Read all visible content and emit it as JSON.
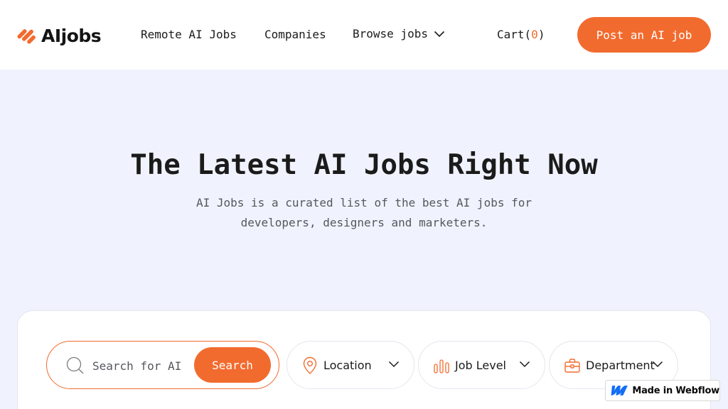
{
  "header": {
    "logo_text": "AIjobs",
    "nav": {
      "remote": "Remote AI Jobs",
      "companies": "Companies",
      "browse": "Browse jobs"
    },
    "cart": {
      "label": "Cart(",
      "count": "0",
      "suffix": ")"
    },
    "post_button": "Post an AI job"
  },
  "hero": {
    "title": "The Latest AI Jobs Right Now",
    "subtitle": "AI Jobs is a curated list of the best AI jobs for developers, designers and marketers."
  },
  "search": {
    "placeholder": "Search for AI",
    "button": "Search"
  },
  "filters": {
    "location": "Location",
    "job_level": "Job Level",
    "department": "Department"
  },
  "badge": {
    "text": "Made in Webflow"
  },
  "colors": {
    "accent": "#f26b2e",
    "background": "#f0f3fd"
  }
}
